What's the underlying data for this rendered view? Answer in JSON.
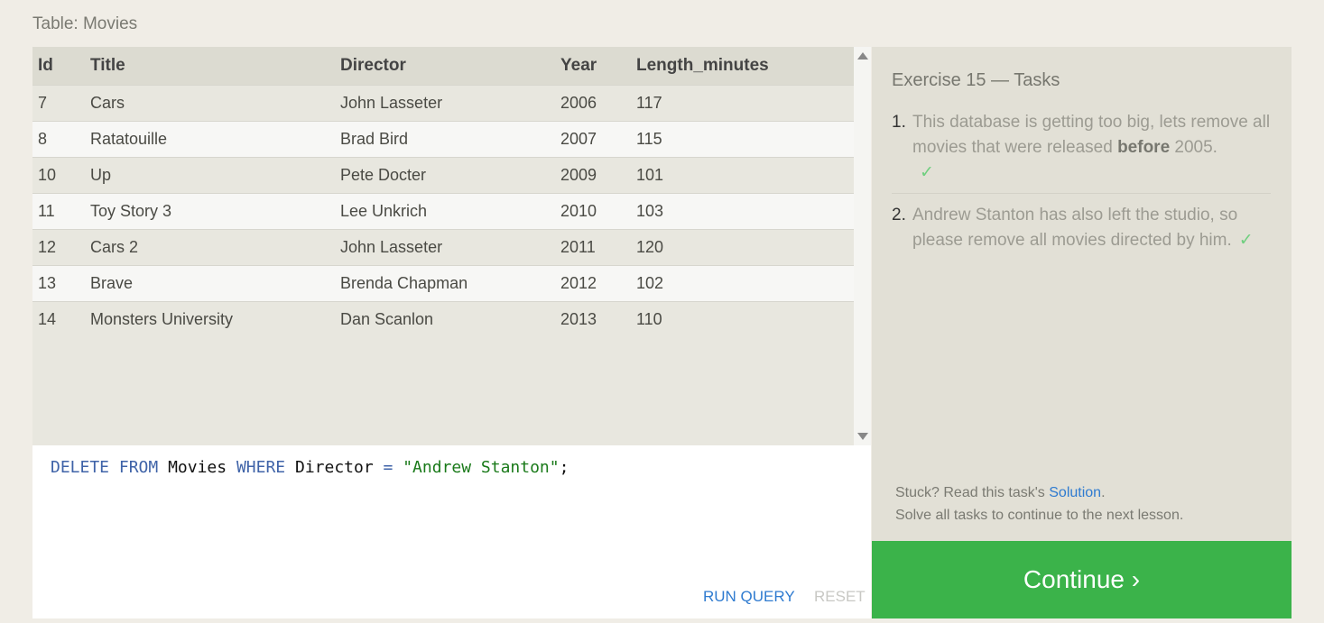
{
  "caption": "Table: Movies",
  "table": {
    "headers": [
      "Id",
      "Title",
      "Director",
      "Year",
      "Length_minutes"
    ],
    "rows": [
      {
        "id": "7",
        "title": "Cars",
        "director": "John Lasseter",
        "year": "2006",
        "length": "117"
      },
      {
        "id": "8",
        "title": "Ratatouille",
        "director": "Brad Bird",
        "year": "2007",
        "length": "115"
      },
      {
        "id": "10",
        "title": "Up",
        "director": "Pete Docter",
        "year": "2009",
        "length": "101"
      },
      {
        "id": "11",
        "title": "Toy Story 3",
        "director": "Lee Unkrich",
        "year": "2010",
        "length": "103"
      },
      {
        "id": "12",
        "title": "Cars 2",
        "director": "John Lasseter",
        "year": "2011",
        "length": "120"
      },
      {
        "id": "13",
        "title": "Brave",
        "director": "Brenda Chapman",
        "year": "2012",
        "length": "102"
      },
      {
        "id": "14",
        "title": "Monsters University",
        "director": "Dan Scanlon",
        "year": "2013",
        "length": "110"
      }
    ]
  },
  "editor": {
    "kw_delete": "DELETE",
    "kw_from": "FROM",
    "table_name": "Movies",
    "kw_where": "WHERE",
    "column": "Director",
    "operator": "=",
    "value": "\"Andrew Stanton\"",
    "terminator": ";",
    "run_label": "RUN QUERY",
    "reset_label": "RESET"
  },
  "tasks": {
    "title": "Exercise 15 — Tasks",
    "items": [
      {
        "num": "1.",
        "text_a": "This database is getting too big, lets remove all movies that were released ",
        "bold": "before",
        "text_b": " 2005.",
        "check": "✓"
      },
      {
        "num": "2.",
        "text_a": "Andrew Stanton has also left the studio, so please remove all movies directed by him.",
        "check": "✓"
      }
    ],
    "help_prefix": "Stuck? Read this task's ",
    "solution_label": "Solution",
    "help_suffix": ".",
    "help_line2": "Solve all tasks to continue to the next lesson."
  },
  "continue_label": "Continue ›",
  "colors": {
    "continue_bg": "#3bb34a",
    "link": "#2f7bd0",
    "check": "#6fcf7f"
  }
}
